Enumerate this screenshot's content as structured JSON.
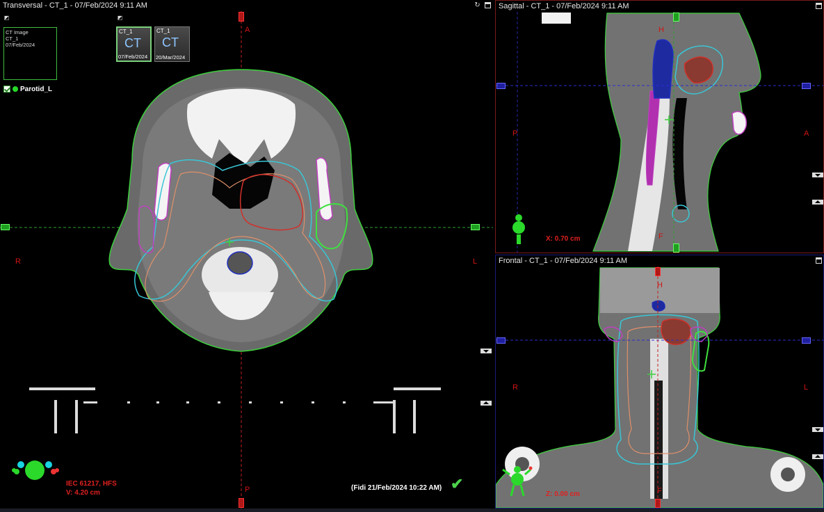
{
  "transversal": {
    "title": "Transversal - CT_1 - 07/Feb/2024 9:11 AM",
    "orient_top": "A",
    "orient_bottom": "P",
    "orient_left": "R",
    "orient_right": "L",
    "position_line1": "IEC 61217, HFS",
    "position_line2": "V: 4.20 cm",
    "approval_text": "(Fidi 21/Feb/2024 10:22 AM)",
    "preview": {
      "line1": "CT Image",
      "line2": "CT_1",
      "line3": "07/Feb/2024"
    },
    "thumbnails": [
      {
        "top": "CT_1",
        "big": "CT",
        "date": "07/Feb/2024"
      },
      {
        "top": "CT_1",
        "big": "CT",
        "date": "20/Mar/2024"
      }
    ],
    "structure_label": "Parotid_L"
  },
  "sagittal": {
    "title": "Sagittal - CT_1 - 07/Feb/2024 9:11 AM",
    "orient_top": "H",
    "orient_bottom": "F",
    "orient_left": "P",
    "orient_right": "A",
    "position": "X: 0.70 cm"
  },
  "frontal": {
    "title": "Frontal - CT_1 - 07/Feb/2024 9:11 AM",
    "orient_top": "H",
    "orient_bottom": "F",
    "orient_left": "R",
    "orient_right": "L",
    "position": "Z: 0.00 cm"
  },
  "colors": {
    "crosshair_green": "#2fa02f",
    "crosshair_blue": "#2c2ccf",
    "crosshair_red": "#c02020",
    "body": "#3ccf3c",
    "ptv_cyan": "#39c6d6",
    "gtv_red": "#d0302a",
    "ctv_orange": "#e0906a",
    "parotid_magenta": "#c040c0",
    "spinal_blue": "#2030c0"
  }
}
